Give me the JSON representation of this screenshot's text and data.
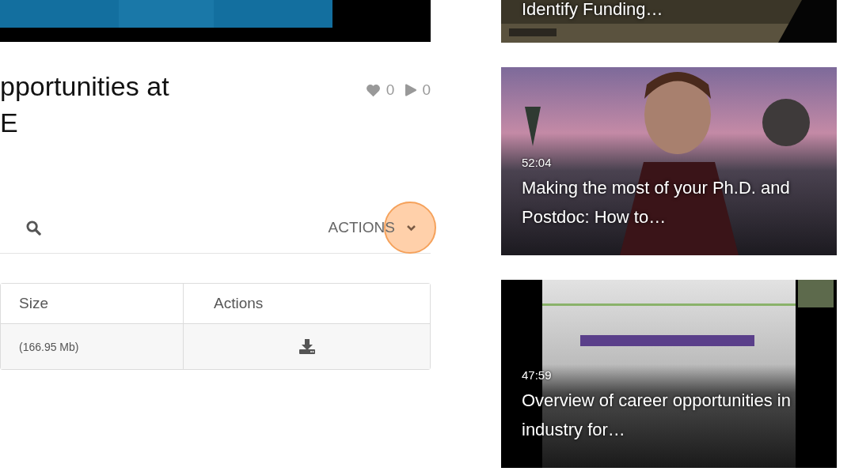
{
  "title": "pportunities at\nE",
  "stats": {
    "likes": "0",
    "plays": "0"
  },
  "toolbar": {
    "actions_label": "ACTIONS",
    "highlighted": true
  },
  "table": {
    "columns": [
      "Size",
      "Actions"
    ],
    "rows": [
      {
        "size": "(166.95 Mb)"
      }
    ]
  },
  "related": [
    {
      "kind": "picture",
      "title": "Identify Funding…"
    },
    {
      "kind": "picture",
      "duration": "52:04",
      "title": "Making the most of your Ph.D. and\nPostdoc: How to…"
    },
    {
      "kind": "picture",
      "duration": "47:59",
      "title": "Overview of career opportunities in\nindustry for…"
    }
  ]
}
